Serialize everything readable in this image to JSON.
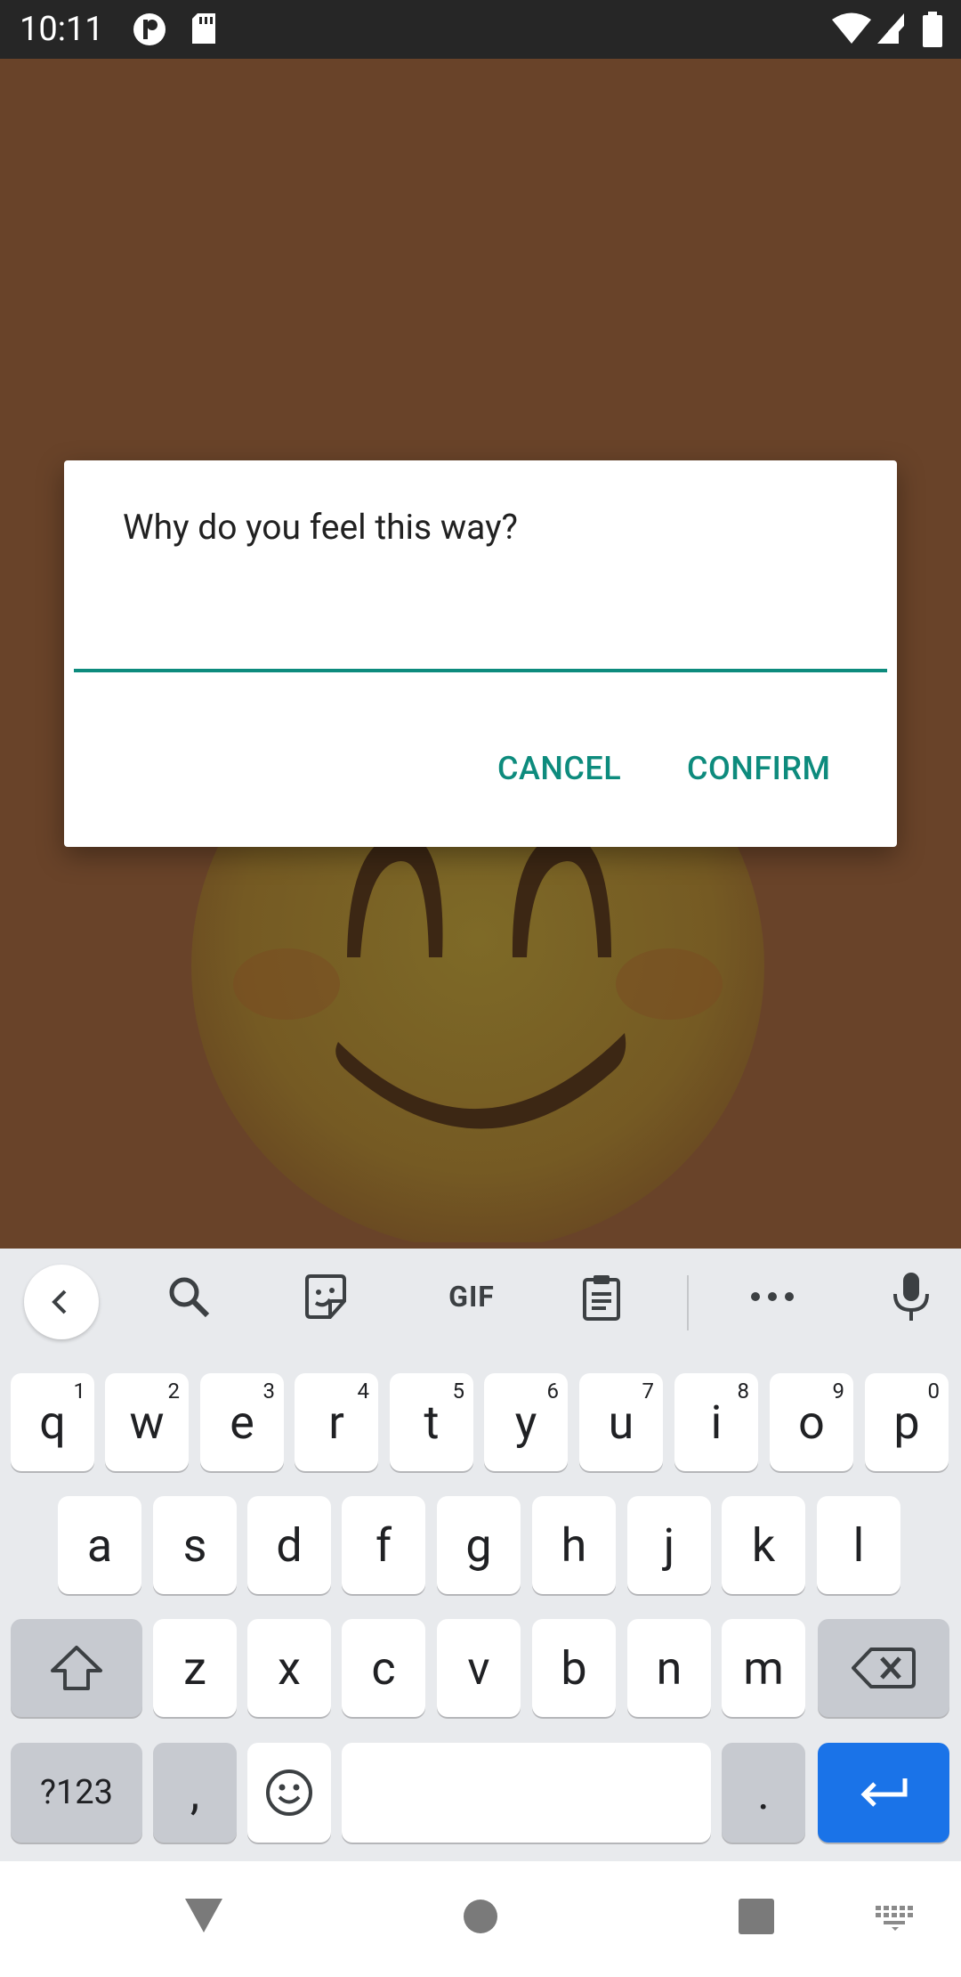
{
  "status_bar": {
    "time": "10:11",
    "icons": [
      "notification-p-icon",
      "sd-card-icon",
      "wifi-icon",
      "signal-icon",
      "battery-icon"
    ]
  },
  "dialog": {
    "title": "Why do you feel this way?",
    "input_value": "",
    "cancel_label": "CANCEL",
    "confirm_label": "CONFIRM",
    "accent_color": "#0d8b7d"
  },
  "background": {
    "color": "#694329",
    "image": "smiling-face-emoji"
  },
  "keyboard": {
    "toolbar": [
      "back-chevron-icon",
      "search-icon",
      "sticker-icon",
      "GIF",
      "clipboard-icon",
      "more-icon",
      "mic-icon"
    ],
    "row1": [
      {
        "key": "q",
        "hint": "1"
      },
      {
        "key": "w",
        "hint": "2"
      },
      {
        "key": "e",
        "hint": "3"
      },
      {
        "key": "r",
        "hint": "4"
      },
      {
        "key": "t",
        "hint": "5"
      },
      {
        "key": "y",
        "hint": "6"
      },
      {
        "key": "u",
        "hint": "7"
      },
      {
        "key": "i",
        "hint": "8"
      },
      {
        "key": "o",
        "hint": "9"
      },
      {
        "key": "p",
        "hint": "0"
      }
    ],
    "row2": [
      "a",
      "s",
      "d",
      "f",
      "g",
      "h",
      "j",
      "k",
      "l"
    ],
    "row3": [
      "z",
      "x",
      "c",
      "v",
      "b",
      "n",
      "m"
    ],
    "row4": {
      "symbols": "?123",
      "comma": ",",
      "period": "."
    },
    "enter_color": "#1a73e8"
  },
  "navbar": {
    "buttons": [
      "back-triangle-icon",
      "home-circle-icon",
      "recents-square-icon",
      "keyboard-switch-icon"
    ]
  }
}
